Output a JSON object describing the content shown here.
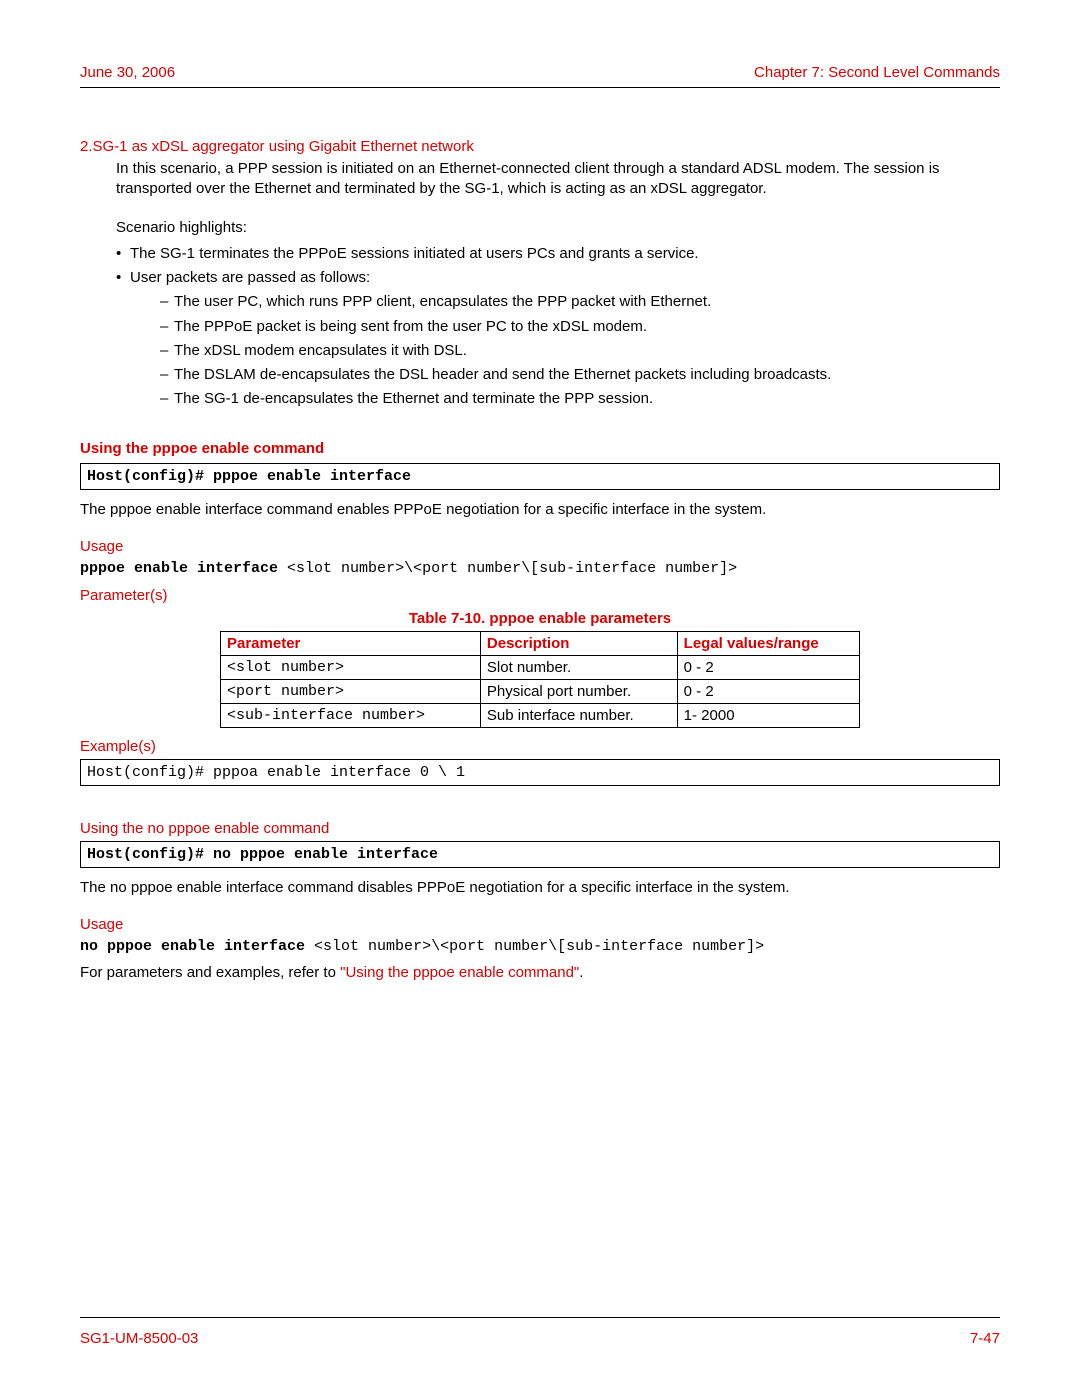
{
  "header": {
    "date": "June 30, 2006",
    "chapter": "Chapter 7: Second Level Commands"
  },
  "scenario": {
    "num": "2.",
    "title": "SG-1 as xDSL aggregator using Gigabit Ethernet network",
    "body": "In this scenario, a PPP session is initiated on an Ethernet-connected client through a standard ADSL modem. The session is transported over the Ethernet and terminated by the SG-1, which is acting as an xDSL aggregator.",
    "highlights_label": "Scenario highlights:",
    "bullets": [
      "The SG-1 terminates the PPPoE sessions initiated at users PCs and grants a service.",
      "User packets are passed as follows:"
    ],
    "dashes": [
      "The user PC, which runs PPP client, encapsulates the PPP packet with Ethernet.",
      "The PPPoE packet is being sent from the user PC to the xDSL modem.",
      "The xDSL modem encapsulates it with DSL.",
      "The DSLAM de-encapsulates the DSL header and send the Ethernet packets including broadcasts.",
      "The SG-1 de-encapsulates the Ethernet and terminate the PPP session."
    ]
  },
  "enable": {
    "heading": "Using the pppoe enable command",
    "cmd": "Host(config)# pppoe enable interface",
    "desc": "The pppoe enable interface command enables PPPoE negotiation for a specific interface in the system.",
    "usage_label": "Usage",
    "usage_bold": "pppoe enable interface ",
    "usage_rest": "<slot number>\\<port number\\[sub-interface number]>",
    "params_label": "Parameter(s)",
    "table_caption": "Table 7-10. pppoe enable parameters",
    "table_headers": [
      "Parameter",
      "Description",
      "Legal values/range"
    ],
    "table_rows": [
      {
        "p": "<slot number>",
        "d": "Slot number.",
        "r": "0 - 2"
      },
      {
        "p": "<port number>",
        "d": "Physical port number.",
        "r": "0 - 2"
      },
      {
        "p": "<sub-interface number>",
        "d": "Sub interface number.",
        "r": "1- 2000"
      }
    ],
    "examples_label": "Example(s)",
    "example_code": "Host(config)# pppoa enable interface 0 \\ 1"
  },
  "noenable": {
    "heading": "Using the no pppoe enable command",
    "cmd": "Host(config)# no pppoe enable interface",
    "desc": "The no pppoe enable interface command disables PPPoE negotiation for a specific interface in the system.",
    "usage_label": "Usage",
    "usage_bold": "no pppoe enable interface ",
    "usage_rest": "<slot number>\\<port number\\[sub-interface number]>",
    "ref_prefix": "For parameters and examples, refer to ",
    "ref_link": "\"Using the pppoe enable command\"",
    "ref_suffix": "."
  },
  "footer": {
    "doc": "SG1-UM-8500-03",
    "page": "7-47"
  }
}
